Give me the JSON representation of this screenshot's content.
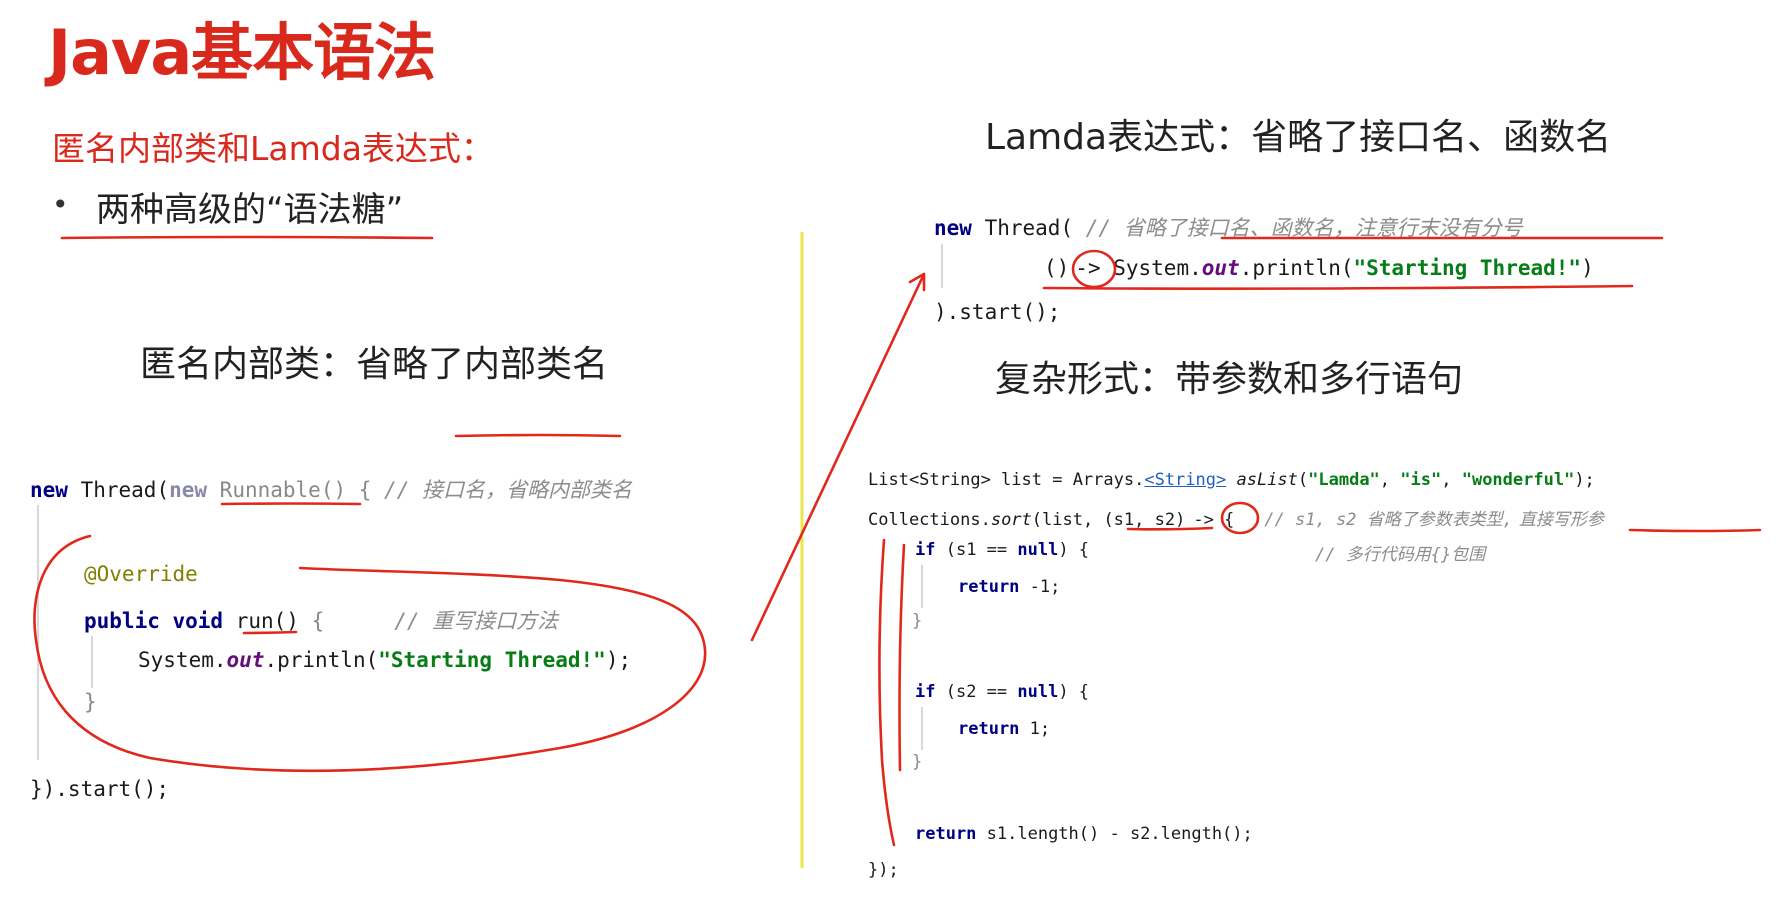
{
  "title": "Java基本语法",
  "subtitle": "匿名内部类和Lamda表达式：",
  "bullet": "两种高级的“语法糖”",
  "anon_heading": "匿名内部类：省略了内部类名",
  "lambda_heading": "Lamda表达式：省略了接口名、函数名",
  "complex_heading": "复杂形式：带参数和多行语句",
  "anon_code": {
    "l1_new": "new",
    "l1_thread": " Thread(",
    "l1_new2": "new",
    "l1_runnable": " Runnable()",
    "l1_brace": " { ",
    "l1_comment": "// 接口名，省略内部类名",
    "l2_annotation": "@Override",
    "l3_kw": "public void",
    "l3_run": " run()",
    "l3_brace": " {",
    "l3_comment": "// 重写接口方法",
    "l4_sys": "System.",
    "l4_out": "out",
    "l4_println": ".println(",
    "l4_str": "\"Starting Thread!\"",
    "l4_end": ");",
    "l5": "}",
    "l6": "}).start();"
  },
  "lambda_code": {
    "l1_new": "new",
    "l1_thread": " Thread( ",
    "l1_comment": "// 省略了接口名、函数名，注意行末没有分号",
    "l2_parens": "()",
    "l2_arrow": "->",
    "l2_sys": " System.",
    "l2_out": "out",
    "l2_println": ".println(",
    "l2_str": "\"Starting Thread!\"",
    "l2_end": ")",
    "l3": ").start();"
  },
  "complex_code": {
    "l1_a": "List<String> list = Arrays.",
    "l1_type": "<String>",
    "l1_method": " asList",
    "l1_open": "(",
    "l1_s1": "\"Lamda\"",
    "l1_comma1": ", ",
    "l1_s2": "\"is\"",
    "l1_comma2": ", ",
    "l1_s3": "\"wonderful\"",
    "l1_end": ");",
    "l2_a": "Collections.",
    "l2_sort": "sort",
    "l2_b": "(list, ",
    "l2_params": "(s1, s2)",
    "l2_arrow": "->",
    "l2_brace": " {",
    "l2_comment_a": "// s1, s2 省略了参数表类型,",
    "l2_comment_b": "直接写形参",
    "l3_if": "if",
    "l3_cond": " (s1 == ",
    "l3_null": "null",
    "l3_end": ") {",
    "l3_comment": "// 多行代码用{}包围",
    "l4_return": "return",
    "l4_val": " -1;",
    "l5": "}",
    "l6_if": "if",
    "l6_cond": " (s2 == ",
    "l6_null": "null",
    "l6_end": ") {",
    "l7_return": "return",
    "l7_val": " 1;",
    "l8": "}",
    "l9_return": "return",
    "l9_val": " s1.length() - s2.length();",
    "l10": "});"
  },
  "colors": {
    "title_red": "#d9281c",
    "annotation_red": "#e0281c",
    "divider_yellow": "#e8e84a",
    "keyword_navy": "#000080",
    "string_green": "#067d17",
    "field_purple": "#660e7a",
    "comment_gray": "#8c8c8c"
  }
}
